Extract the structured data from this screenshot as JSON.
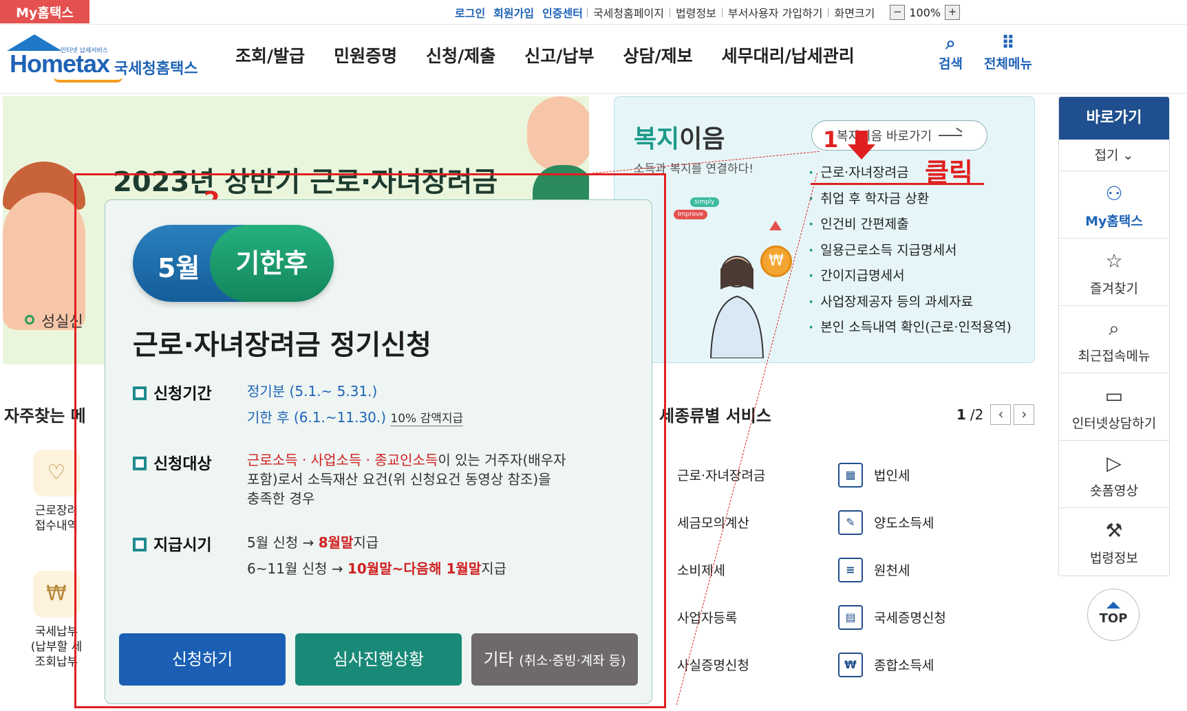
{
  "topbar": {
    "my_hometax": "My홈택스",
    "links_blue": [
      "로그인",
      "회원가입",
      "인증센터"
    ],
    "links": [
      "국세청홈페이지",
      "법령정보",
      "부서사용자 가입하기",
      "화면크기"
    ],
    "zoom_minus": "−",
    "zoom_level": "100%",
    "zoom_plus": "+"
  },
  "header": {
    "logo_small": "인터넷 납세서비스",
    "logo_brand": "Hometax",
    "logo_korean": "국세청홈택스",
    "gnb": [
      "조회/발급",
      "민원증명",
      "신청/제출",
      "신고/납부",
      "상담/제보",
      "세무대리/납세관리"
    ],
    "search": "검색",
    "all_menu": "전체메뉴"
  },
  "banner": {
    "peek_title": "2023년 상반기 근로·자녀장려금",
    "peek_sub": "성실신"
  },
  "welfare": {
    "title_hl": "복지",
    "title_rest": "이음",
    "subtitle": "소득과 복지를 연결하다!",
    "shortcut": "복지이음 바로가기",
    "items": [
      "근로·자녀장려금",
      "취업 후 학자금 상환",
      "인건비 간편제출",
      "일용근로소득 지급명세서",
      "간이지급명세서",
      "사업장제공자 등의 과세자료",
      "본인 소득내역 확인(근로·인적용역)"
    ],
    "badges": [
      "simply",
      "Improve"
    ]
  },
  "quick": {
    "header": "바로가기",
    "fold": "접기",
    "items": [
      {
        "icon": "person-icon",
        "label": "My홈택스"
      },
      {
        "icon": "star-icon",
        "label": "즐겨찾기"
      },
      {
        "icon": "recent-icon",
        "label": "최근접속메뉴"
      },
      {
        "icon": "chat-icon",
        "label": "인터넷상담하기"
      },
      {
        "icon": "play-icon",
        "label": "숏폼영상"
      },
      {
        "icon": "gavel-icon",
        "label": "법령정보"
      }
    ],
    "top": "TOP"
  },
  "below": {
    "freq_title": "자주찾는 메",
    "freq_items": [
      "근로장려\n접수내역",
      "국세납부\n(납부할 세\n조회납부"
    ],
    "svc_title": "세종류별 서비스",
    "page_cur": "1",
    "page_total": "/2",
    "svc_left": [
      "근로·자녀장려금",
      "세금모의계산",
      "소비제세",
      "사업자등록",
      "사실증명신청"
    ],
    "svc_right": [
      "법인세",
      "양도소득세",
      "원천세",
      "국세증명신청",
      "종합소득세"
    ]
  },
  "annotations": {
    "num1": "1",
    "num2": "2",
    "click": "클릭",
    "color": "#e02020"
  },
  "popup": {
    "month": "5월",
    "stage": "기한후",
    "title": "근로·자녀장려금 정기신청",
    "period_label": "신청기간",
    "period_regular": "정기분 (5.1.~ 5.31.)",
    "period_late": "기한 후 (6.1.~11.30.)",
    "period_late_note": "10% 감액지급",
    "target_label": "신청대상",
    "target_red": "근로소득 · 사업소득 · 종교인소득",
    "target_rest1": "이 있는 거주자(배우자",
    "target_rest2": "포함)로서 소득재산 요건(위 신청요건 동영상 참조)을",
    "target_rest3": "충족한 경우",
    "pay_label": "지급시기",
    "pay1_a": "5월 신청 →",
    "pay1_b": "8월말",
    "pay1_c": "지급",
    "pay2_a": "6~11월 신청 →",
    "pay2_b": "10월말~다음해 1월말",
    "pay2_c": "지급",
    "btn_apply": "신청하기",
    "btn_status": "심사진행상황",
    "btn_etc": "기타",
    "btn_etc_sub": "(취소·증빙·계좌 등)",
    "colors": {
      "apply": "#1a5fb4",
      "status": "#1a8a78",
      "etc": "#6e6a6a"
    }
  }
}
